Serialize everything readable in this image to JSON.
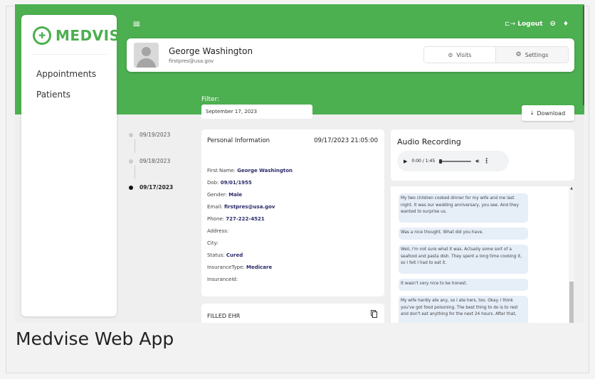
{
  "app": {
    "logo_text": "MEDVISE",
    "logo_icon": "medvise-logo-icon"
  },
  "sidebar": {
    "items": [
      {
        "label": "Appointments"
      },
      {
        "label": "Patients"
      }
    ]
  },
  "topbar": {
    "menu_icon": "hamburger-icon",
    "logout_label": "Logout",
    "logout_glyph": "⊏→",
    "account_icon": "account-icon",
    "notification_icon": "bell-icon"
  },
  "patient": {
    "name": "George Washington",
    "email": "firstpres@usa.gov"
  },
  "tabs": [
    {
      "label": "Visits",
      "icon": "visits-icon",
      "active": true
    },
    {
      "label": "Settings",
      "icon": "gear-icon",
      "active": false
    }
  ],
  "filter": {
    "label": "Filter:",
    "value": "September 17, 2023"
  },
  "download": {
    "label": "Download",
    "icon": "download-icon"
  },
  "timeline": [
    {
      "date": "09/19/2023",
      "active": false
    },
    {
      "date": "09/18/2023",
      "active": false
    },
    {
      "date": "09/17/2023",
      "active": true
    }
  ],
  "personal_info": {
    "title": "Personal Information",
    "datetime": "09/17/2023 21:05:00",
    "fields": [
      {
        "label": "First Name:",
        "value": "George Washington"
      },
      {
        "label": "Dob:",
        "value": "09/01/1955"
      },
      {
        "label": "Gender:",
        "value": "Male"
      },
      {
        "label": "Email:",
        "value": "firstpres@usa.gov"
      },
      {
        "label": "Phone:",
        "value": "727-222-4521"
      },
      {
        "label": "Address:",
        "value": ""
      },
      {
        "label": "City:",
        "value": ""
      },
      {
        "label": "Status:",
        "value": "Cured"
      },
      {
        "label": "InsuranceType:",
        "value": "Medicare"
      },
      {
        "label": "InsuranceId:",
        "value": ""
      }
    ]
  },
  "ehr": {
    "title": "FILLED EHR",
    "copy_icon": "copy-icon"
  },
  "audio": {
    "title": "Audio Recording",
    "time": "0:00 / 1:45",
    "progress": 0.0
  },
  "transcript": {
    "messages": [
      {
        "text": "My two children cooked dinner for my wife and me last night. It was our wedding anniversary, you see. And they wanted to surprise us."
      },
      {
        "text": "Was a nice thought. What did you have."
      },
      {
        "text": "Well, I'm not sure what it was. Actually some sort of a seafood and pasta dish. They spent a long time cooking it, so I felt I had to eat it."
      },
      {
        "text": "It wasn't very nice to be honest."
      },
      {
        "text": "My wife hardly ate any, so I ate hers, too. Okay. I think you've got food poisoning. The best thing to do is to rest and don't eat anything for the next 24 hours. After that,"
      }
    ]
  },
  "caption": "Medvise Web App",
  "colors": {
    "brand_green": "#4caf50"
  }
}
